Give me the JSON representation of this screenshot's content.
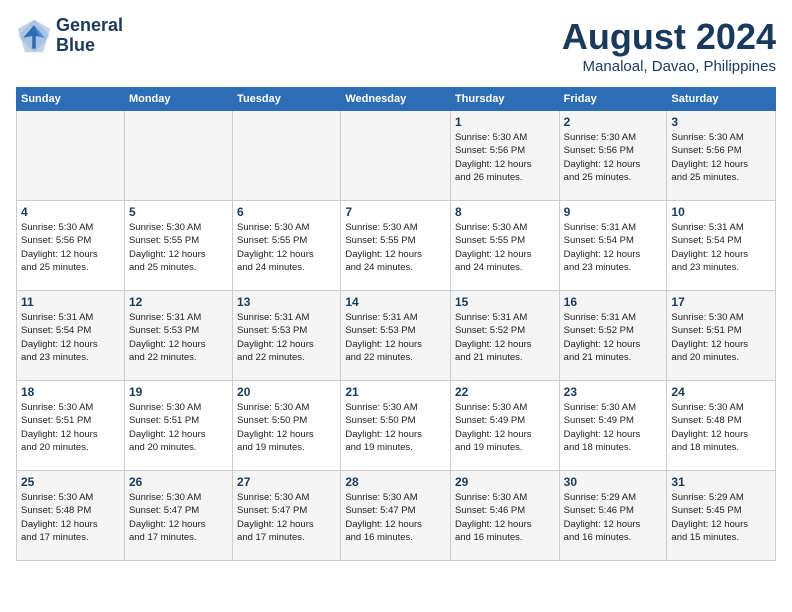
{
  "header": {
    "logo_line1": "General",
    "logo_line2": "Blue",
    "month_title": "August 2024",
    "location": "Manaloal, Davao, Philippines"
  },
  "days_of_week": [
    "Sunday",
    "Monday",
    "Tuesday",
    "Wednesday",
    "Thursday",
    "Friday",
    "Saturday"
  ],
  "weeks": [
    [
      {
        "day": "",
        "text": ""
      },
      {
        "day": "",
        "text": ""
      },
      {
        "day": "",
        "text": ""
      },
      {
        "day": "",
        "text": ""
      },
      {
        "day": "1",
        "text": "Sunrise: 5:30 AM\nSunset: 5:56 PM\nDaylight: 12 hours\nand 26 minutes."
      },
      {
        "day": "2",
        "text": "Sunrise: 5:30 AM\nSunset: 5:56 PM\nDaylight: 12 hours\nand 25 minutes."
      },
      {
        "day": "3",
        "text": "Sunrise: 5:30 AM\nSunset: 5:56 PM\nDaylight: 12 hours\nand 25 minutes."
      }
    ],
    [
      {
        "day": "4",
        "text": "Sunrise: 5:30 AM\nSunset: 5:56 PM\nDaylight: 12 hours\nand 25 minutes."
      },
      {
        "day": "5",
        "text": "Sunrise: 5:30 AM\nSunset: 5:55 PM\nDaylight: 12 hours\nand 25 minutes."
      },
      {
        "day": "6",
        "text": "Sunrise: 5:30 AM\nSunset: 5:55 PM\nDaylight: 12 hours\nand 24 minutes."
      },
      {
        "day": "7",
        "text": "Sunrise: 5:30 AM\nSunset: 5:55 PM\nDaylight: 12 hours\nand 24 minutes."
      },
      {
        "day": "8",
        "text": "Sunrise: 5:30 AM\nSunset: 5:55 PM\nDaylight: 12 hours\nand 24 minutes."
      },
      {
        "day": "9",
        "text": "Sunrise: 5:31 AM\nSunset: 5:54 PM\nDaylight: 12 hours\nand 23 minutes."
      },
      {
        "day": "10",
        "text": "Sunrise: 5:31 AM\nSunset: 5:54 PM\nDaylight: 12 hours\nand 23 minutes."
      }
    ],
    [
      {
        "day": "11",
        "text": "Sunrise: 5:31 AM\nSunset: 5:54 PM\nDaylight: 12 hours\nand 23 minutes."
      },
      {
        "day": "12",
        "text": "Sunrise: 5:31 AM\nSunset: 5:53 PM\nDaylight: 12 hours\nand 22 minutes."
      },
      {
        "day": "13",
        "text": "Sunrise: 5:31 AM\nSunset: 5:53 PM\nDaylight: 12 hours\nand 22 minutes."
      },
      {
        "day": "14",
        "text": "Sunrise: 5:31 AM\nSunset: 5:53 PM\nDaylight: 12 hours\nand 22 minutes."
      },
      {
        "day": "15",
        "text": "Sunrise: 5:31 AM\nSunset: 5:52 PM\nDaylight: 12 hours\nand 21 minutes."
      },
      {
        "day": "16",
        "text": "Sunrise: 5:31 AM\nSunset: 5:52 PM\nDaylight: 12 hours\nand 21 minutes."
      },
      {
        "day": "17",
        "text": "Sunrise: 5:30 AM\nSunset: 5:51 PM\nDaylight: 12 hours\nand 20 minutes."
      }
    ],
    [
      {
        "day": "18",
        "text": "Sunrise: 5:30 AM\nSunset: 5:51 PM\nDaylight: 12 hours\nand 20 minutes."
      },
      {
        "day": "19",
        "text": "Sunrise: 5:30 AM\nSunset: 5:51 PM\nDaylight: 12 hours\nand 20 minutes."
      },
      {
        "day": "20",
        "text": "Sunrise: 5:30 AM\nSunset: 5:50 PM\nDaylight: 12 hours\nand 19 minutes."
      },
      {
        "day": "21",
        "text": "Sunrise: 5:30 AM\nSunset: 5:50 PM\nDaylight: 12 hours\nand 19 minutes."
      },
      {
        "day": "22",
        "text": "Sunrise: 5:30 AM\nSunset: 5:49 PM\nDaylight: 12 hours\nand 19 minutes."
      },
      {
        "day": "23",
        "text": "Sunrise: 5:30 AM\nSunset: 5:49 PM\nDaylight: 12 hours\nand 18 minutes."
      },
      {
        "day": "24",
        "text": "Sunrise: 5:30 AM\nSunset: 5:48 PM\nDaylight: 12 hours\nand 18 minutes."
      }
    ],
    [
      {
        "day": "25",
        "text": "Sunrise: 5:30 AM\nSunset: 5:48 PM\nDaylight: 12 hours\nand 17 minutes."
      },
      {
        "day": "26",
        "text": "Sunrise: 5:30 AM\nSunset: 5:47 PM\nDaylight: 12 hours\nand 17 minutes."
      },
      {
        "day": "27",
        "text": "Sunrise: 5:30 AM\nSunset: 5:47 PM\nDaylight: 12 hours\nand 17 minutes."
      },
      {
        "day": "28",
        "text": "Sunrise: 5:30 AM\nSunset: 5:47 PM\nDaylight: 12 hours\nand 16 minutes."
      },
      {
        "day": "29",
        "text": "Sunrise: 5:30 AM\nSunset: 5:46 PM\nDaylight: 12 hours\nand 16 minutes."
      },
      {
        "day": "30",
        "text": "Sunrise: 5:29 AM\nSunset: 5:46 PM\nDaylight: 12 hours\nand 16 minutes."
      },
      {
        "day": "31",
        "text": "Sunrise: 5:29 AM\nSunset: 5:45 PM\nDaylight: 12 hours\nand 15 minutes."
      }
    ]
  ]
}
